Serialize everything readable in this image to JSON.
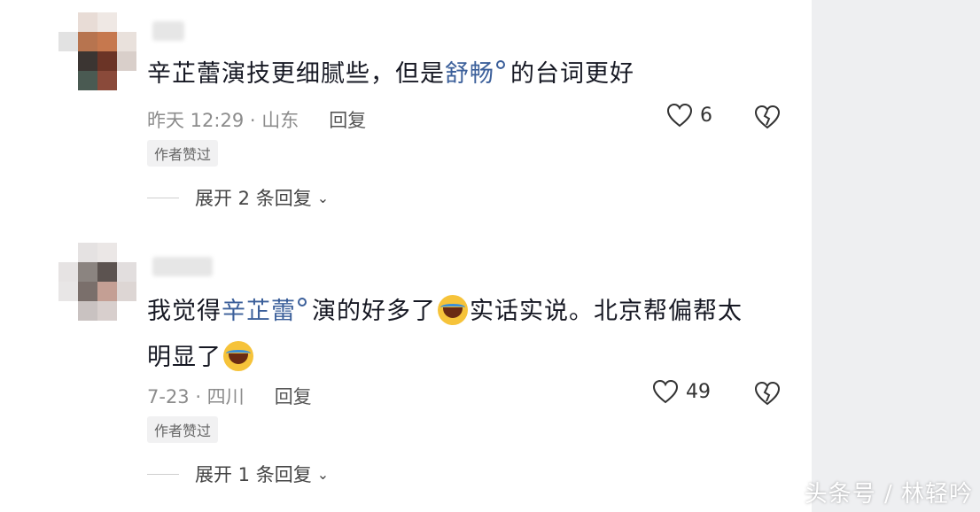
{
  "comments": [
    {
      "text_before": "辛芷蕾演技更细腻些，但是",
      "highlight": "舒畅",
      "text_after": "的台词更好",
      "time_location": "昨天 12:29 · 山东",
      "reply_label": "回复",
      "likes": "6",
      "badge": "作者赞过",
      "expand_label": "展开 2 条回复"
    },
    {
      "text_before": "我觉得",
      "highlight": "辛芷蕾",
      "text_mid": "演的好多了",
      "text_after": "实话实说。北京帮偏帮太",
      "text_line2": "明显了",
      "time_location": "7-23 · 四川",
      "reply_label": "回复",
      "likes": "49",
      "badge": "作者赞过",
      "expand_label": "展开 1 条回复"
    }
  ],
  "watermark": "头条号 / 林轻吟"
}
